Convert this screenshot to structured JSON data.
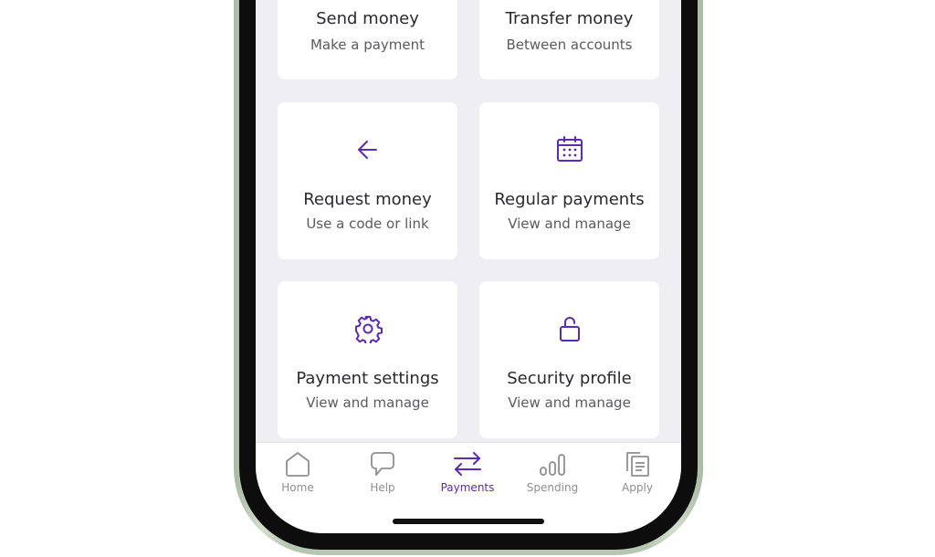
{
  "colors": {
    "accent": "#5b2bb5",
    "screen_background": "#efeef3",
    "nav_inactive": "#8e8e93"
  },
  "tiles": [
    {
      "title": "Send money",
      "subtitle": "Make a payment",
      "icon": "send-icon"
    },
    {
      "title": "Transfer money",
      "subtitle": "Between accounts",
      "icon": "transfer-icon"
    },
    {
      "title": "Request money",
      "subtitle": "Use a code or link",
      "icon": "arrow-left-icon"
    },
    {
      "title": "Regular payments",
      "subtitle": "View and manage",
      "icon": "calendar-icon"
    },
    {
      "title": "Payment settings",
      "subtitle": "View and manage",
      "icon": "gear-icon"
    },
    {
      "title": "Security profile",
      "subtitle": "View and manage",
      "icon": "unlock-icon"
    }
  ],
  "nav": {
    "active": "Payments",
    "items": [
      {
        "label": "Home",
        "icon": "home-icon"
      },
      {
        "label": "Help",
        "icon": "chat-bubble-icon"
      },
      {
        "label": "Payments",
        "icon": "transfer-arrows-icon"
      },
      {
        "label": "Spending",
        "icon": "bar-chart-icon"
      },
      {
        "label": "Apply",
        "icon": "documents-icon"
      }
    ]
  }
}
